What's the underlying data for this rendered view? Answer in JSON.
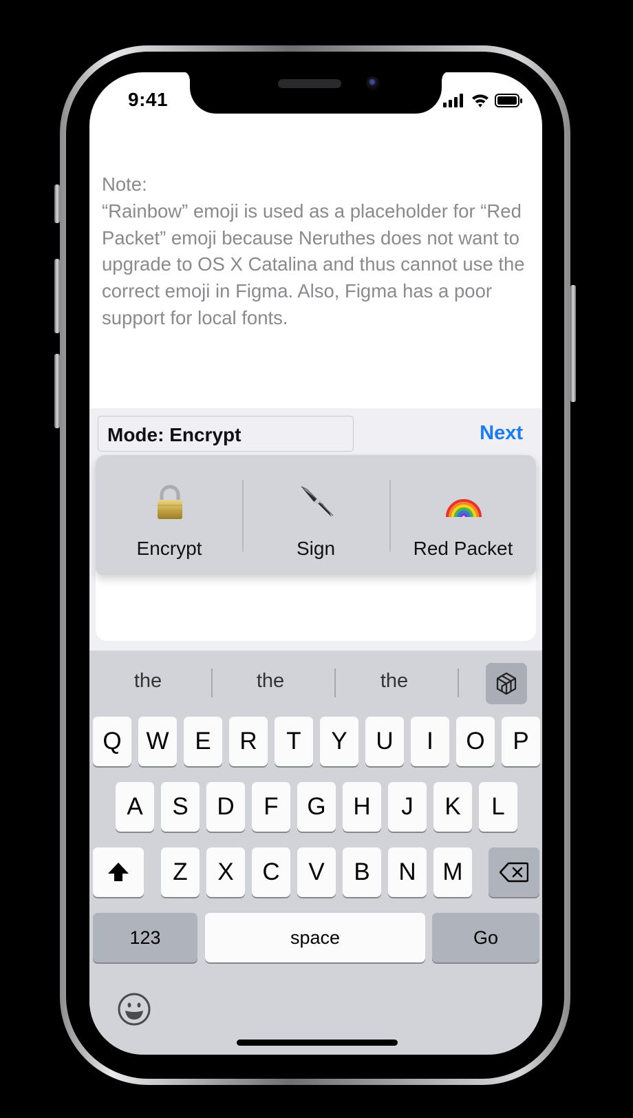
{
  "status_bar": {
    "time": "9:41"
  },
  "note": {
    "text": "Note:\n“Rainbow” emoji is used as a placeholder for “Red Packet” emoji because Neruthes does not want to upgrade to OS X Catalina and thus cannot use the correct emoji in Figma. Also, Figma has a poor support for local fonts."
  },
  "toolbar": {
    "mode_label": "Mode: Encrypt",
    "next_label": "Next"
  },
  "actions": [
    {
      "label": "Encrypt",
      "icon": "lock-icon"
    },
    {
      "label": "Sign",
      "icon": "fountain-pen-icon"
    },
    {
      "label": "Red Packet",
      "icon": "rainbow-icon"
    }
  ],
  "keyboard": {
    "suggestions": [
      "the",
      "the",
      "the"
    ],
    "row1": [
      "Q",
      "W",
      "E",
      "R",
      "T",
      "Y",
      "U",
      "I",
      "O",
      "P"
    ],
    "row2": [
      "A",
      "S",
      "D",
      "F",
      "G",
      "H",
      "J",
      "K",
      "L"
    ],
    "row3": [
      "Z",
      "X",
      "C",
      "V",
      "B",
      "N",
      "M"
    ],
    "numbers_label": "123",
    "space_label": "space",
    "go_label": "Go"
  },
  "colors": {
    "accent": "#1a7cf5",
    "note_text": "#8a8a8e",
    "keyboard_bg": "#d1d3d9",
    "action_bar_bg": "#d2d4da"
  }
}
